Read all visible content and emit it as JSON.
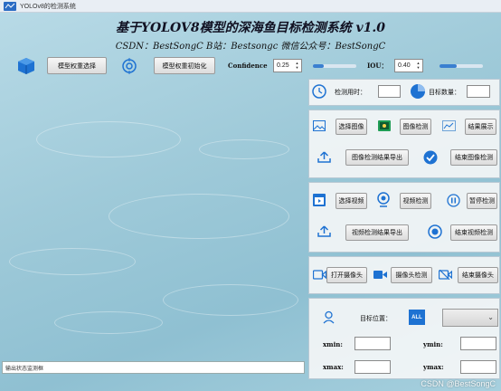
{
  "window": {
    "title": "YOLOv8的检测系统"
  },
  "header": {
    "main_title": "基于YOLOV8模型的深海鱼目标检测系统 v1.0",
    "sub_title": "CSDN：BestSongC   B站：Bestsongc   微信公众号：BestSongC"
  },
  "toolbar": {
    "select_weight": "模型权重选择",
    "init_weight": "模型权重初始化",
    "confidence_label": "Confidence",
    "confidence_value": "0.25",
    "confidence_level": 0.25,
    "iou_label": "IOU：",
    "iou_value": "0.40",
    "iou_level": 0.4
  },
  "stats": {
    "time_label": "检测用时：",
    "count_label": "目标数量："
  },
  "image": {
    "select": "选择图像",
    "detect": "图像检测",
    "show": "结果展示",
    "export": "图像检测结果导出",
    "end": "结束图像检测"
  },
  "video": {
    "select": "选择视频",
    "detect": "视频检测",
    "pause": "暂停检测",
    "export": "视频检测结果导出",
    "end": "结束视频检测"
  },
  "camera": {
    "open": "打开摄像头",
    "detect": "摄像头检测",
    "end": "结束摄像头"
  },
  "target": {
    "position_label": "目标位置：",
    "all_badge": "ALL",
    "xmin": "xmin:",
    "ymin": "ymin:",
    "xmax": "xmax:",
    "ymax": "ymax:"
  },
  "status": {
    "placeholder": "输出状态监测框"
  },
  "watermark": "CSDN @BestSongC",
  "colors": {
    "accent": "#1f6fd6",
    "panel": "#f7f7f7"
  }
}
